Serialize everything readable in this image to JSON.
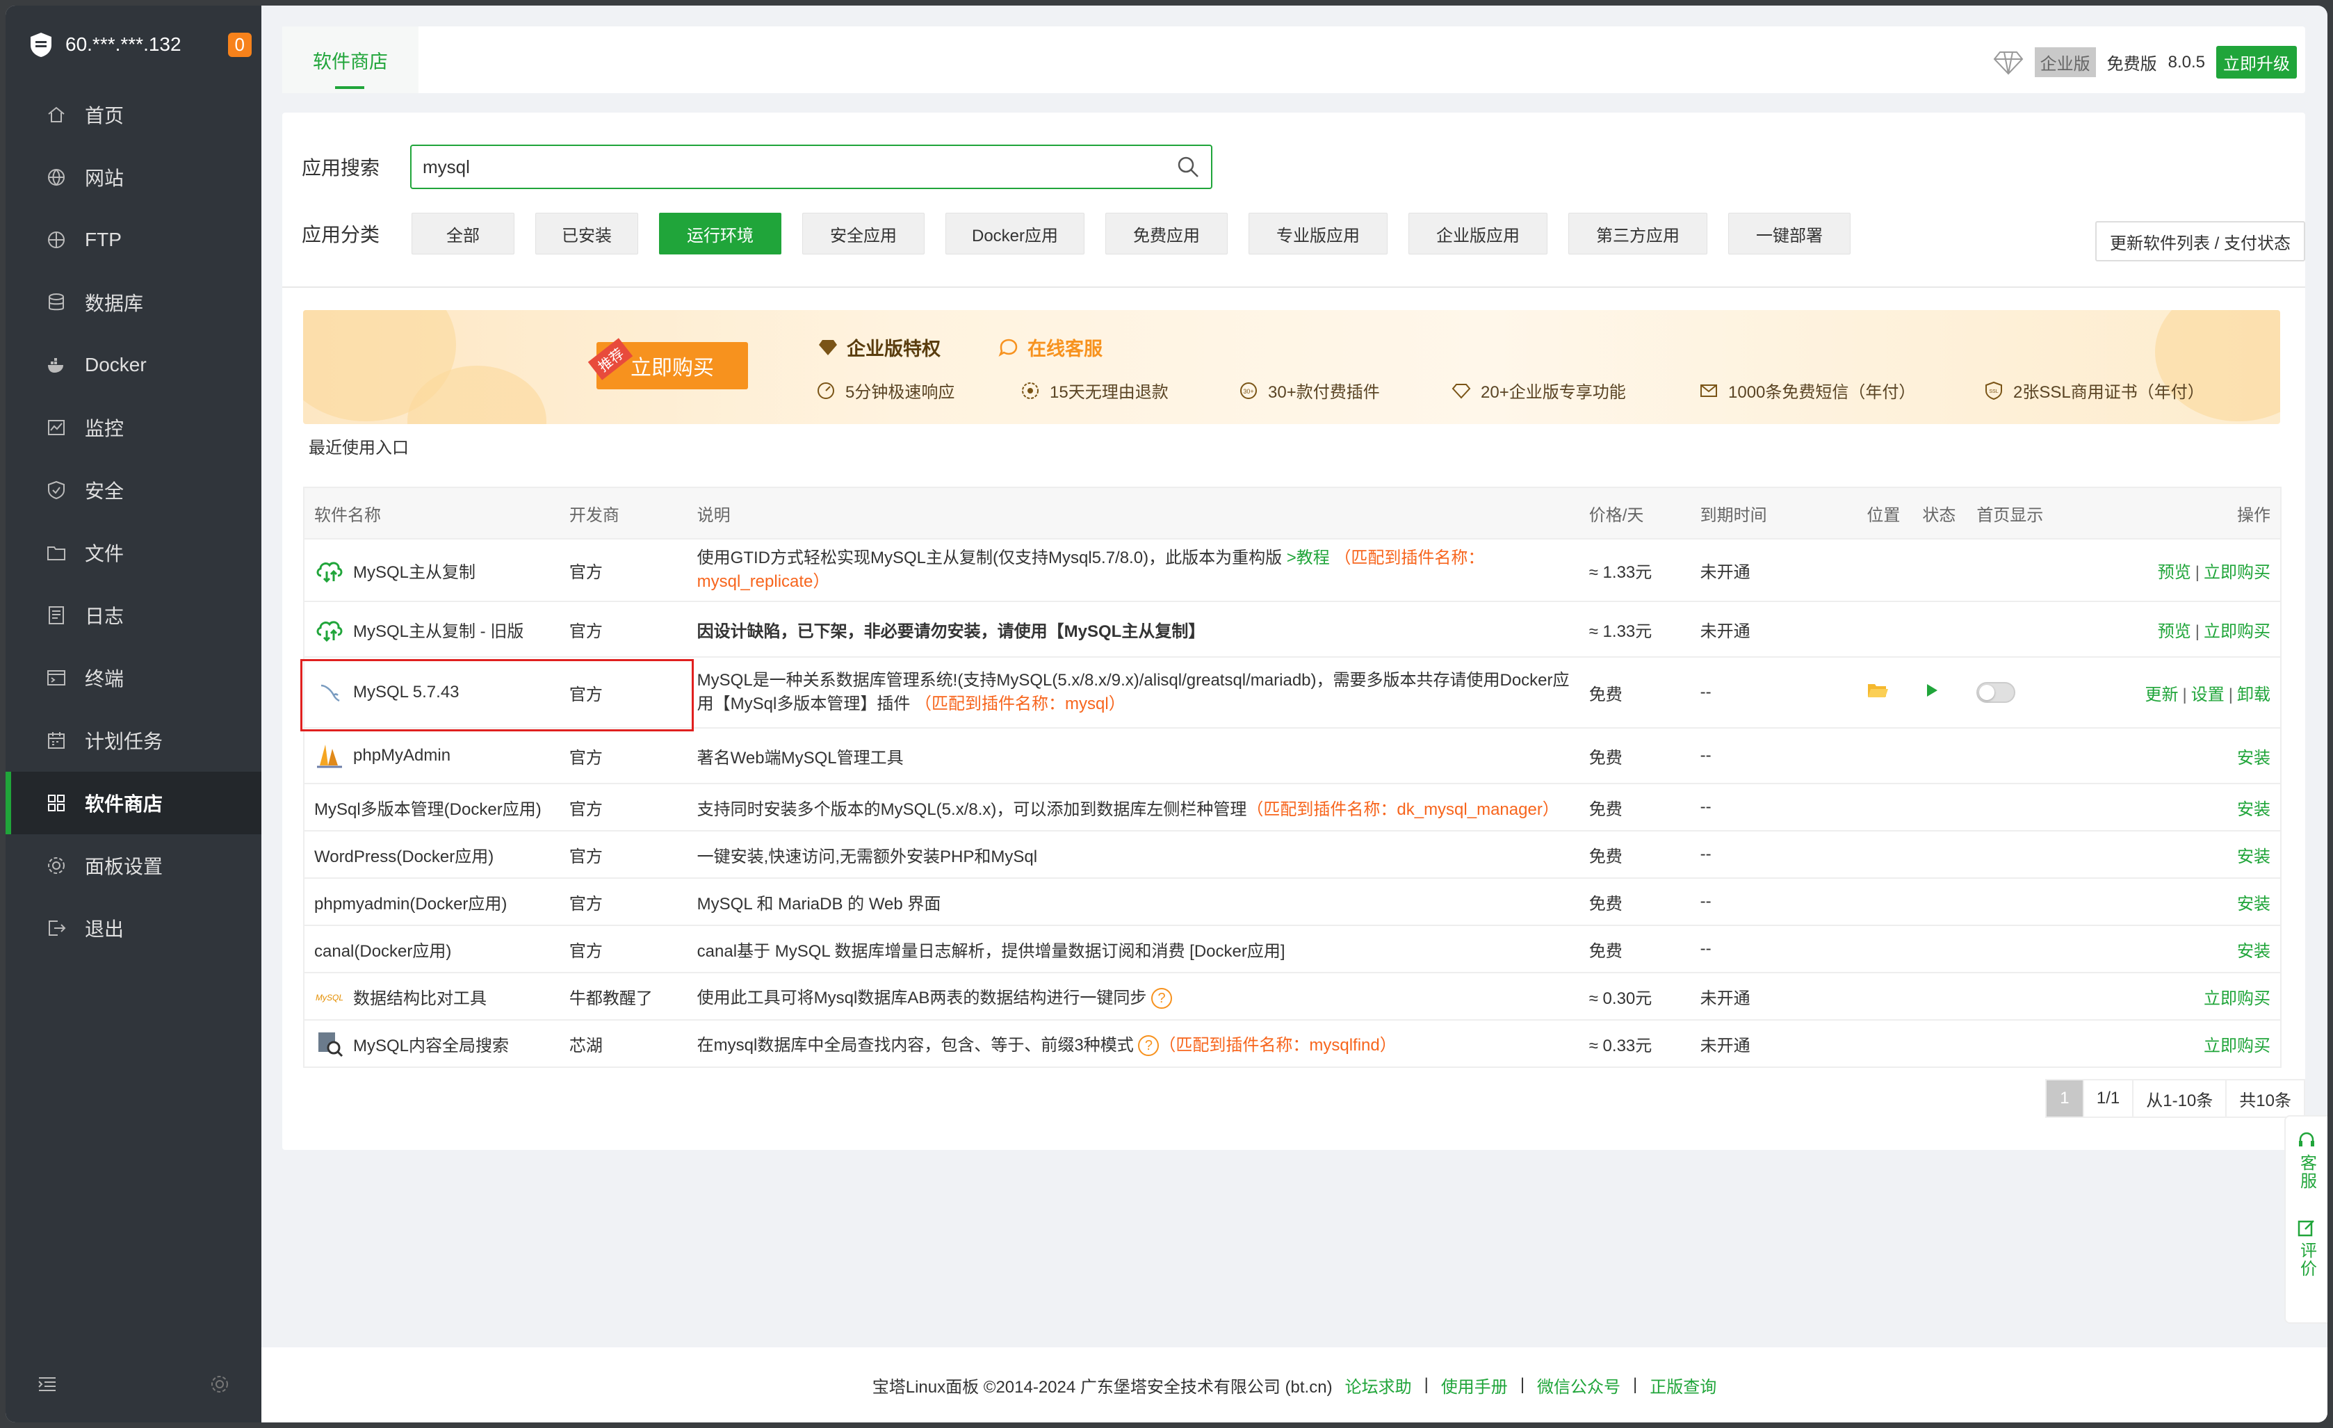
{
  "sidebar": {
    "host": "60.***.***.132",
    "badge": "0",
    "items": [
      {
        "label": "首页",
        "icon": "home-icon"
      },
      {
        "label": "网站",
        "icon": "globe-icon"
      },
      {
        "label": "FTP",
        "icon": "ftp-icon"
      },
      {
        "label": "数据库",
        "icon": "database-icon"
      },
      {
        "label": "Docker",
        "icon": "docker-icon"
      },
      {
        "label": "监控",
        "icon": "monitor-icon"
      },
      {
        "label": "安全",
        "icon": "shield-icon"
      },
      {
        "label": "文件",
        "icon": "folder-icon"
      },
      {
        "label": "日志",
        "icon": "log-icon"
      },
      {
        "label": "终端",
        "icon": "terminal-icon"
      },
      {
        "label": "计划任务",
        "icon": "calendar-icon"
      },
      {
        "label": "软件商店",
        "icon": "grid-icon"
      },
      {
        "label": "面板设置",
        "icon": "gear-icon"
      },
      {
        "label": "退出",
        "icon": "logout-icon"
      }
    ]
  },
  "header": {
    "tab": "软件商店",
    "edition_enterprise": "企业版",
    "edition_free": "免费版",
    "version": "8.0.5",
    "upgrade": "立即升级"
  },
  "search": {
    "label": "应用搜索",
    "value": "mysql"
  },
  "categories": {
    "label": "应用分类",
    "items": [
      "全部",
      "已安装",
      "运行环境",
      "安全应用",
      "Docker应用",
      "免费应用",
      "专业版应用",
      "企业版应用",
      "第三方应用",
      "一键部署"
    ],
    "active_index": 2,
    "refresh": "更新软件列表 / 支付状态"
  },
  "banner": {
    "recommend": "推荐",
    "buy": "立即购买",
    "title": "企业版特权",
    "service": "在线客服",
    "features": [
      "5分钟极速响应",
      "15天无理由退款",
      "30+款付费插件",
      "20+企业版专享功能",
      "1000条免费短信（年付）",
      "2张SSL商用证书（年付）"
    ]
  },
  "recent": "最近使用入口",
  "table": {
    "headers": [
      "软件名称",
      "开发商",
      "说明",
      "价格/天",
      "到期时间",
      "位置",
      "状态",
      "首页显示",
      "操作"
    ],
    "rows": [
      {
        "name": "MySQL主从复制",
        "vendor": "官方",
        "desc": "使用GTID方式轻松实现MySQL主从复制(仅支持Mysql5.7/8.0)，此版本为重构版",
        "link": ">教程",
        "match": "（匹配到插件名称：mysql_replicate）",
        "price": "≈ 1.33元",
        "expire": "未开通",
        "ops": [
          "预览",
          "立即购买"
        ]
      },
      {
        "name": "MySQL主从复制 - 旧版",
        "vendor": "官方",
        "desc_red": "因设计缺陷，已下架，非必要请勿安装，请使用【MySQL主从复制】",
        "price": "≈ 1.33元",
        "expire": "未开通",
        "ops": [
          "预览",
          "立即购买"
        ]
      },
      {
        "name": "MySQL 5.7.43",
        "vendor": "官方",
        "desc": "MySQL是一种关系数据库管理系统!(支持MySQL(5.x/8.x/9.x)/alisql/greatsql/mariadb)，需要多版本共存请使用Docker应用【MySql多版本管理】插件",
        "match": "（匹配到插件名称：mysql）",
        "price": "免费",
        "expire": "--",
        "ops": [
          "更新",
          "设置",
          "卸载"
        ]
      },
      {
        "name": "phpMyAdmin",
        "vendor": "官方",
        "desc": "著名Web端MySQL管理工具",
        "price": "免费",
        "expire": "--",
        "ops": [
          "安装"
        ]
      },
      {
        "name": "MySql多版本管理(Docker应用)",
        "vendor": "官方",
        "desc": "支持同时安装多个版本的MySQL(5.x/8.x)，可以添加到数据库左侧栏种管理",
        "match": "（匹配到插件名称：dk_mysql_manager）",
        "price": "免费",
        "expire": "--",
        "ops": [
          "安装"
        ]
      },
      {
        "name": "WordPress(Docker应用)",
        "vendor": "官方",
        "desc": "一键安装,快速访问,无需额外安装PHP和MySql",
        "price": "免费",
        "expire": "--",
        "ops": [
          "安装"
        ]
      },
      {
        "name": "phpmyadmin(Docker应用)",
        "vendor": "官方",
        "desc": "MySQL 和 MariaDB 的 Web 界面",
        "price": "免费",
        "expire": "--",
        "ops": [
          "安装"
        ]
      },
      {
        "name": "canal(Docker应用)",
        "vendor": "官方",
        "desc": "canal基于 MySQL 数据库增量日志解析，提供增量数据订阅和消费 [Docker应用]",
        "price": "免费",
        "expire": "--",
        "ops": [
          "安装"
        ]
      },
      {
        "name": "数据结构比对工具",
        "vendor": "牛都教醒了",
        "desc": "使用此工具可将Mysql数据库AB两表的数据结构进行一键同步",
        "price": "≈ 0.30元",
        "expire": "未开通",
        "ops": [
          "立即购买"
        ]
      },
      {
        "name": "MySQL内容全局搜索",
        "vendor": "芯湖",
        "desc": "在mysql数据库中全局查找内容，包含、等于、前缀3种模式",
        "match": "（匹配到插件名称：mysqlfind）",
        "price": "≈ 0.33元",
        "expire": "未开通",
        "ops": [
          "立即购买"
        ]
      }
    ]
  },
  "pager": {
    "current": "1",
    "pages": "1/1",
    "range": "从1-10条",
    "total": "共10条"
  },
  "footer": {
    "copyright": "宝塔Linux面板 ©2014-2024 广东堡塔安全技术有限公司 (bt.cn)",
    "links": [
      "论坛求助",
      "使用手册",
      "微信公众号",
      "正版查询"
    ]
  },
  "float": {
    "service": "客服",
    "review": "评价"
  }
}
